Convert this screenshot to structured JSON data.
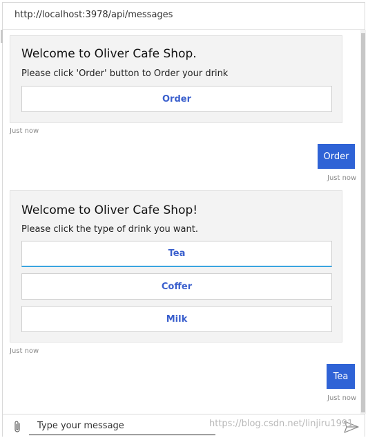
{
  "url": "http://localhost:3978/api/messages",
  "messages": {
    "card1": {
      "title": "Welcome to Oliver Cafe Shop.",
      "text": "Please click 'Order' button to Order your drink",
      "buttons": [
        "Order"
      ],
      "timestamp": "Just now"
    },
    "user1": {
      "text": "Order",
      "timestamp": "Just now"
    },
    "card2": {
      "title": "Welcome to Oliver Cafe Shop!",
      "text": "Please click the type of drink you want.",
      "buttons": [
        "Tea",
        "Coffer",
        "Milk"
      ],
      "timestamp": "Just now"
    },
    "user2": {
      "text": "Tea",
      "timestamp": "Just now"
    }
  },
  "composer": {
    "placeholder": "Type your message"
  },
  "watermark": "https://blog.csdn.net/linjiru1991",
  "colors": {
    "accent": "#2f63d6",
    "button_text": "#3a5fcd",
    "focus_underline": "#3aa4e0",
    "card_bg": "#f3f3f3"
  },
  "icons": {
    "attach": "paperclip-icon",
    "send": "send-icon"
  }
}
